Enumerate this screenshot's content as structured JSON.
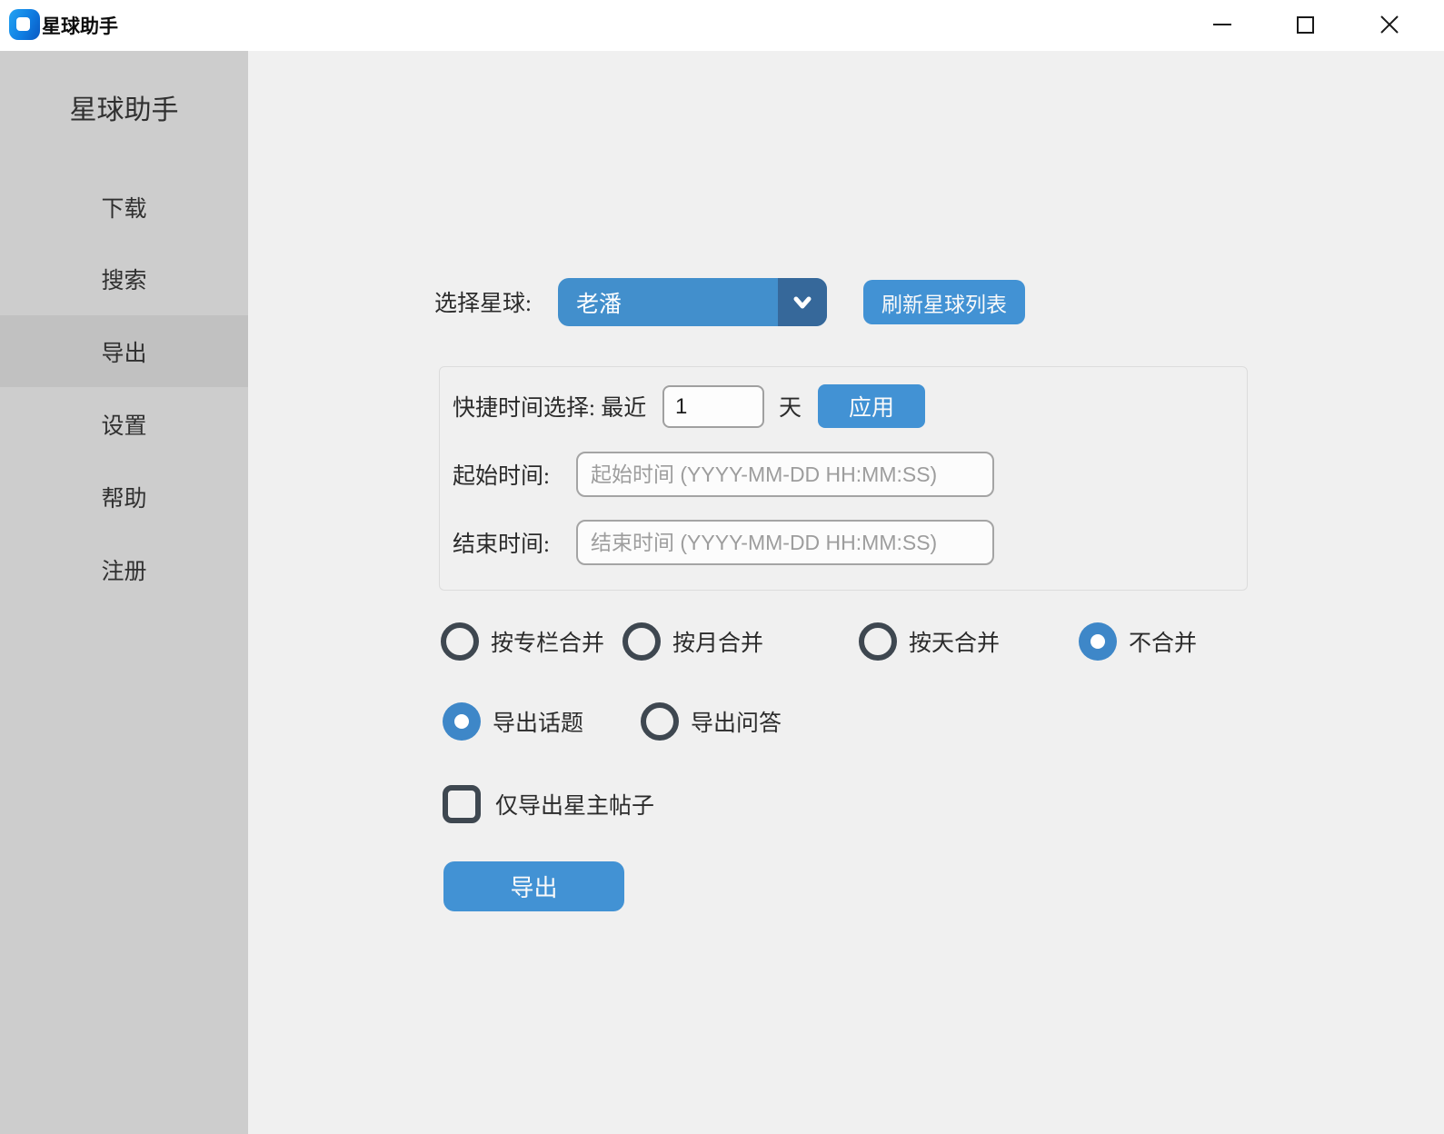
{
  "window": {
    "title": "星球助手"
  },
  "sidebar": {
    "header": "星球助手",
    "items": [
      {
        "label": "下载",
        "selected": false
      },
      {
        "label": "搜索",
        "selected": false
      },
      {
        "label": "导出",
        "selected": true
      },
      {
        "label": "设置",
        "selected": false
      },
      {
        "label": "帮助",
        "selected": false
      },
      {
        "label": "注册",
        "selected": false
      }
    ]
  },
  "main": {
    "planet": {
      "label": "选择星球:",
      "selected_value": "老潘",
      "refresh_button": "刷新星球列表"
    },
    "time_box": {
      "quick_label": "快捷时间选择: 最近",
      "quick_value": "1",
      "quick_unit": "天",
      "apply_button": "应用",
      "start_label": "起始时间:",
      "start_placeholder": "起始时间 (YYYY-MM-DD HH:MM:SS)",
      "end_label": "结束时间:",
      "end_placeholder": "结束时间 (YYYY-MM-DD HH:MM:SS)"
    },
    "merge_options": [
      {
        "label": "按专栏合并",
        "selected": false
      },
      {
        "label": "按月合并",
        "selected": false
      },
      {
        "label": "按天合并",
        "selected": false
      },
      {
        "label": "不合并",
        "selected": true
      }
    ],
    "export_type_options": [
      {
        "label": "导出话题",
        "selected": true
      },
      {
        "label": "导出问答",
        "selected": false
      }
    ],
    "owner_only_checkbox": {
      "label": "仅导出星主帖子",
      "checked": false
    },
    "export_button": "导出"
  },
  "colors": {
    "primary_blue": "#4292d4",
    "dropdown_arrow_blue": "#36689a",
    "radio_selected_blue": "#3e87c8",
    "dark_ring": "#3e4750",
    "sidebar_bg": "#cdcdcd",
    "sidebar_selected_bg": "#c1c1c1",
    "titlebar_bg": "#ffffff",
    "main_bg": "#f0f0f0"
  }
}
